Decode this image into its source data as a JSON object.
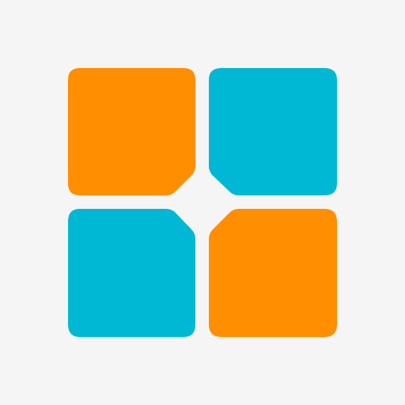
{
  "icon": {
    "name": "four-tile-grid-icon",
    "tiles": [
      {
        "position": "top-left",
        "color": "#FF8F00"
      },
      {
        "position": "top-right",
        "color": "#00B8D4"
      },
      {
        "position": "bottom-left",
        "color": "#00B8D4"
      },
      {
        "position": "bottom-right",
        "color": "#FF8F00"
      }
    ]
  },
  "colors": {
    "background": "#F5F5F5",
    "orange": "#FF8F00",
    "cyan": "#00B8D4"
  }
}
